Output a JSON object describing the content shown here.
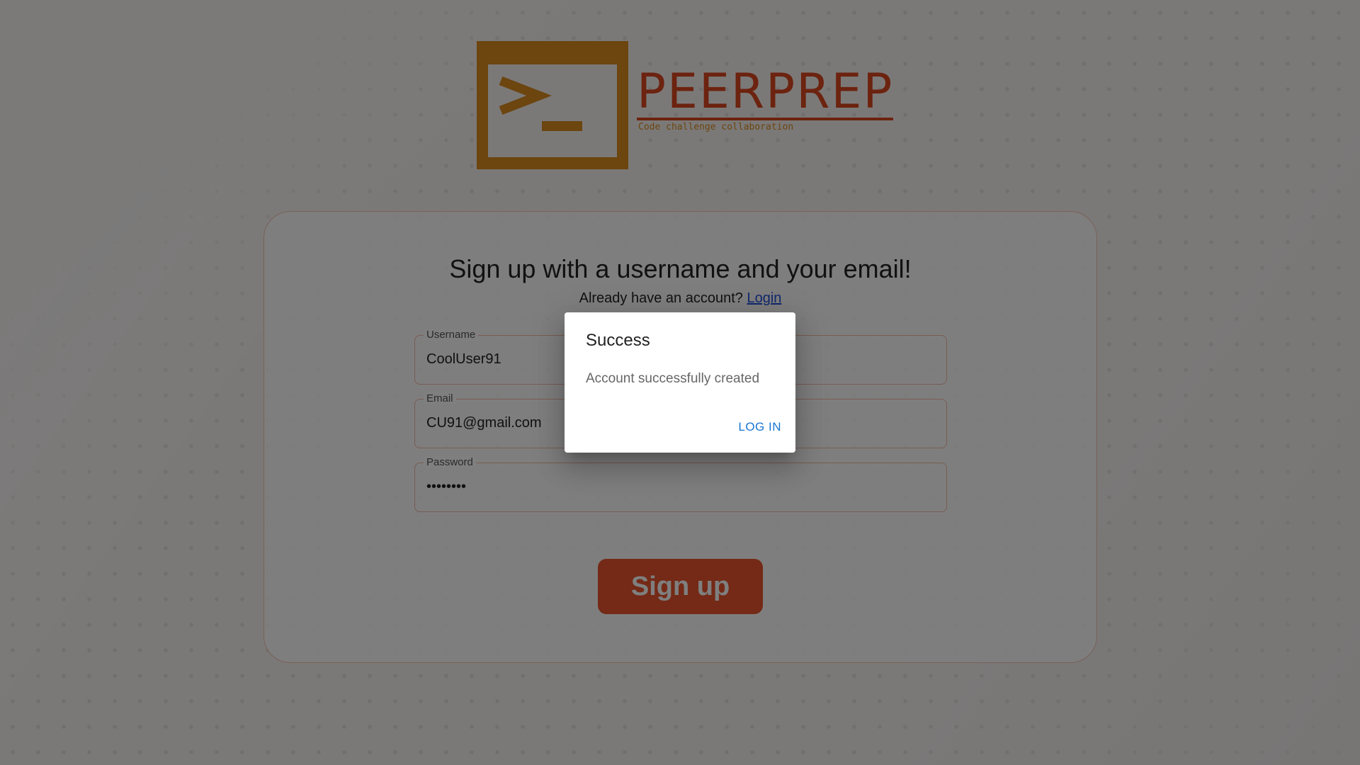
{
  "logo": {
    "title": "PEERPREP",
    "subtitle": "Code challenge collaboration",
    "icon": "terminal-prompt-icon",
    "colors": {
      "box": "#d98a1f",
      "title": "#d9461f"
    }
  },
  "signup": {
    "heading": "Sign up with a username and your email!",
    "already_text": "Already have an account?",
    "login_link": "Login",
    "fields": {
      "username": {
        "label": "Username",
        "value": "CoolUser91"
      },
      "email": {
        "label": "Email",
        "value": "CU91@gmail.com"
      },
      "password": {
        "label": "Password",
        "value": "••••••••"
      }
    },
    "button": "Sign up",
    "button_color": "#e8552d"
  },
  "dialog": {
    "title": "Success",
    "message": "Account successfully created",
    "action": "LOG IN",
    "action_color": "#1976d2"
  }
}
